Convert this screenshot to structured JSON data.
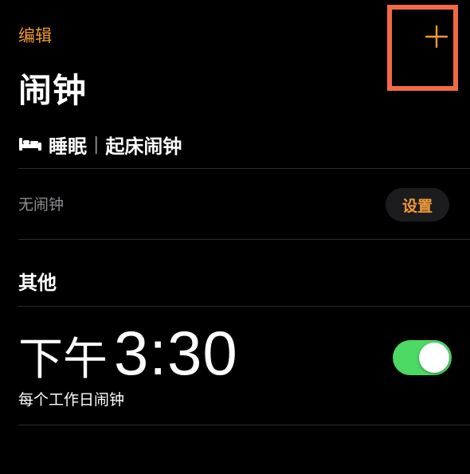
{
  "header": {
    "edit_label": "编辑",
    "add_icon": "plus-icon",
    "title": "闹钟"
  },
  "sleep": {
    "icon": "bed-icon",
    "label": "睡眠",
    "separator": "|",
    "wake_label": "起床闹钟",
    "no_alarm_text": "无闹钟",
    "setup_label": "设置"
  },
  "others": {
    "section_title": "其他",
    "alarms": [
      {
        "ampm": "下午",
        "time": "3:30",
        "repeat": "每个工作日闹钟",
        "enabled": true
      }
    ]
  },
  "colors": {
    "accent": "#F09A37",
    "toggle_on": "#4CD964",
    "highlight": "#F26A45",
    "background": "#000000",
    "secondary_text": "#8E8E93"
  }
}
